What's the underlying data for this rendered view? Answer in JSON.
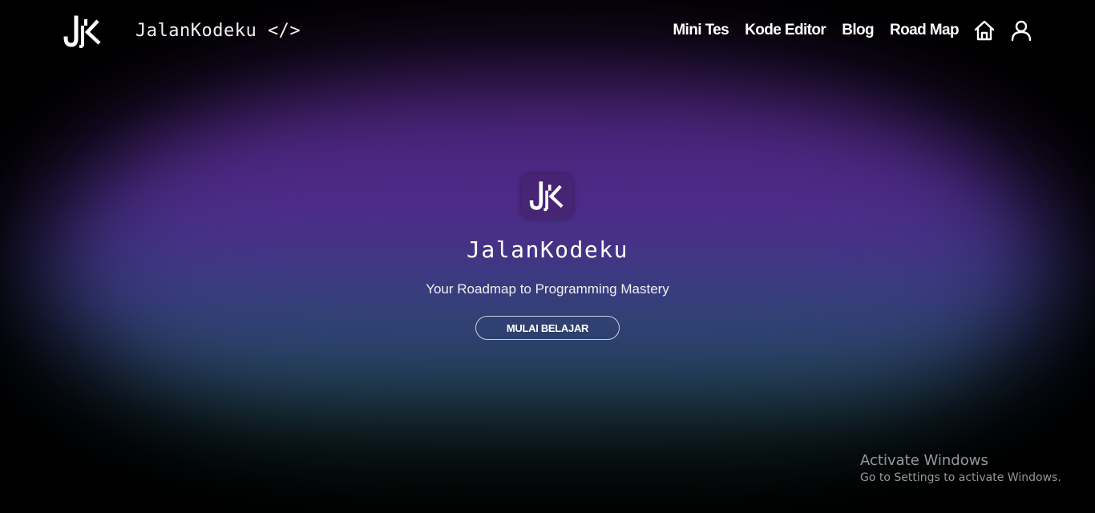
{
  "header": {
    "logo_alt": "JK",
    "brand": "JalanKodeku </>",
    "nav": [
      {
        "label": "Mini Tes"
      },
      {
        "label": "Kode Editor"
      },
      {
        "label": "Blog"
      },
      {
        "label": "Road Map"
      }
    ],
    "icons": [
      "home-icon",
      "user-icon"
    ]
  },
  "hero": {
    "logo_alt": "JK",
    "title": "JalanKodeku",
    "subtitle": "Your Roadmap to Programming Mastery",
    "cta_label": "MULAI BELAJAR"
  },
  "watermark": {
    "title": "Activate Windows",
    "subtitle": "Go to Settings to activate Windows."
  },
  "colors": {
    "background": "#000000",
    "glow_purple": "#4e2680",
    "glow_teal": "#26475f",
    "text": "#ffffff"
  }
}
